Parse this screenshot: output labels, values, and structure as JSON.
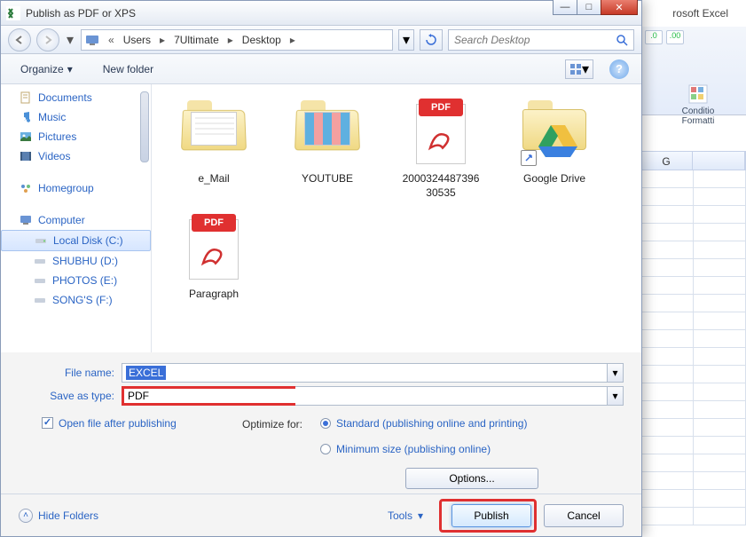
{
  "excel": {
    "app_title": "rosoft Excel",
    "cond_format": "Conditio\nFormatti",
    "col_g": "G"
  },
  "dialog": {
    "title": "Publish as PDF or XPS"
  },
  "breadcrumb": {
    "items": [
      "Users",
      "7Ultimate",
      "Desktop"
    ]
  },
  "search": {
    "placeholder": "Search Desktop"
  },
  "toolbar": {
    "organize": "Organize",
    "new_folder": "New folder"
  },
  "sidebar": {
    "libraries": [
      "Documents",
      "Music",
      "Pictures",
      "Videos"
    ],
    "homegroup": "Homegroup",
    "computer": "Computer",
    "drives": [
      "Local Disk (C:)",
      "SHUBHU (D:)",
      "PHOTOS (E:)",
      "SONG'S (F:)"
    ]
  },
  "files": [
    {
      "name": "e_Mail",
      "type": "folder"
    },
    {
      "name": "YOUTUBE",
      "type": "folder-thumbs"
    },
    {
      "name": "2000324487396\n30535",
      "type": "pdf"
    },
    {
      "name": "Google Drive",
      "type": "gdrive"
    },
    {
      "name": "Paragraph",
      "type": "pdf"
    }
  ],
  "form": {
    "filename_label": "File name:",
    "filename_value": "EXCEL",
    "savetype_label": "Save as type:",
    "savetype_value": "PDF"
  },
  "opts": {
    "open_after": "Open file after publishing",
    "optimize_for": "Optimize for:",
    "standard": "Standard (publishing online and printing)",
    "minimum": "Minimum size (publishing online)",
    "options_btn": "Options..."
  },
  "bottom": {
    "hide_folders": "Hide Folders",
    "tools": "Tools",
    "publish": "Publish",
    "cancel": "Cancel"
  }
}
